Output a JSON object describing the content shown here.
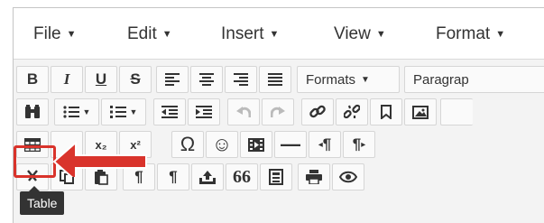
{
  "menubar": {
    "items": [
      {
        "label": "File",
        "caret": "▼"
      },
      {
        "label": "Edit",
        "caret": "▼"
      },
      {
        "label": "Insert",
        "caret": "▼"
      },
      {
        "label": "View",
        "caret": "▼"
      },
      {
        "label": "Format",
        "caret": "▼"
      }
    ]
  },
  "toolbar": {
    "row1": {
      "bold": "B",
      "italic": "I",
      "underline": "U",
      "strikethrough": "S",
      "formats_label": "Formats",
      "paragraph_label": "Paragrap"
    },
    "row2": {
      "find_icon": "binoculars-icon",
      "bullet_list_icon": "bullet-list-icon",
      "numbered_list_icon": "numbered-list-icon",
      "outdent_icon": "outdent-icon",
      "indent_icon": "indent-icon",
      "undo_icon": "undo-icon",
      "redo_icon": "redo-icon",
      "link_icon": "link-icon",
      "unlink_icon": "unlink-icon",
      "anchor_icon": "bookmark-icon",
      "image_icon": "image-icon"
    },
    "row3": {
      "table_icon": "table-icon",
      "subscript_label": "x₂",
      "superscript_label": "x²",
      "charmap_label": "Ω",
      "emoticons_label": "☺",
      "media_icon": "media-icon",
      "hr_label": "—",
      "ltr_label": "¶",
      "rtl_label": "¶"
    },
    "row4": {
      "cut_icon": "cut-icon",
      "copy_icon": "copy-icon",
      "paste_icon": "paste-icon",
      "pilcrow1_label": "¶",
      "pilcrow2_label": "¶",
      "upload_icon": "upload-icon",
      "blockquote_label": "66",
      "template_icon": "template-icon",
      "print_icon": "print-icon",
      "preview_icon": "eye-icon"
    }
  },
  "tooltip": {
    "text": "Table"
  },
  "colors": {
    "highlight": "#d9332b",
    "tooltip_bg": "#333333"
  }
}
